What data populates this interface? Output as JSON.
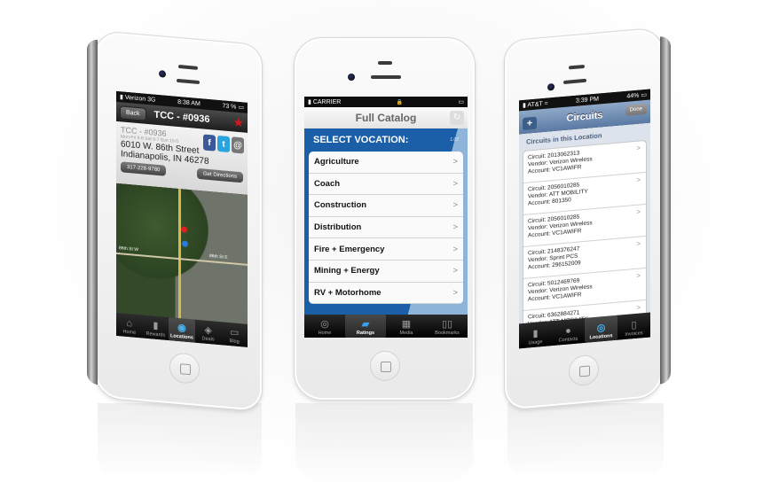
{
  "phones": {
    "left": {
      "status": {
        "carrier": "Verizon",
        "network": "3G",
        "time": "8:38 AM",
        "battery": "73 %"
      },
      "nav": {
        "back_label": "Back",
        "title": "TCC - #0936",
        "favorite_icon": "star-icon"
      },
      "location": {
        "name": "TCC - #0936",
        "hours": "Mon-Fri 9-8 Sat 9-7 Sun 10-5",
        "address_line1": "6010 W. 86th Street",
        "address_line2": "Indianapolis, IN 46278",
        "phone_button": "317-228-9780",
        "directions_button": "Get Directions",
        "social": [
          {
            "name": "facebook",
            "glyph": "f"
          },
          {
            "name": "twitter",
            "glyph": "t"
          },
          {
            "name": "email",
            "glyph": "@"
          }
        ]
      },
      "map": {
        "labels": [
          "86th St W",
          "86th St E"
        ]
      },
      "tabs": [
        {
          "label": "Home",
          "icon": "⌂",
          "active": false
        },
        {
          "label": "Rewards",
          "icon": "▮",
          "active": false
        },
        {
          "label": "Locations",
          "icon": "◉",
          "active": true
        },
        {
          "label": "Deals",
          "icon": "◈",
          "active": false
        },
        {
          "label": "Blog",
          "icon": "▭",
          "active": false
        }
      ]
    },
    "middle": {
      "status": {
        "carrier": "CARRIER",
        "lock_icon": "🔒"
      },
      "nav": {
        "title": "Full Catalog",
        "refresh_icon": "↻"
      },
      "header": {
        "title": "SELECT VOCATION:",
        "version": "1.02"
      },
      "vocations": [
        "Agriculture",
        "Coach",
        "Construction",
        "Distribution",
        "Fire + Emergency",
        "Mining + Energy",
        "RV + Motorhome"
      ],
      "chevron": ">",
      "tabs": [
        {
          "label": "Home",
          "icon": "◎",
          "active": false
        },
        {
          "label": "Ratings",
          "icon": "▰",
          "active": true
        },
        {
          "label": "Media",
          "icon": "▦",
          "active": false
        },
        {
          "label": "Bookmarks",
          "icon": "▯▯",
          "active": false
        }
      ]
    },
    "right": {
      "status": {
        "carrier": "AT&T",
        "time": "3:39 PM",
        "battery": "44%"
      },
      "nav": {
        "title": "Circuits",
        "add_label": "+",
        "done_label": "Done"
      },
      "section_title": "Circuits in this Location",
      "circuits": [
        {
          "circuit": "Circuit: 2013062313",
          "vendor": "Vendor: Verizon Wireless",
          "account": "Account: VC1AWIFR"
        },
        {
          "circuit": "Circuit: 2056010285",
          "vendor": "Vendor: ATT MOBILITY",
          "account": "Account: 801350"
        },
        {
          "circuit": "Circuit: 2056010285",
          "vendor": "Vendor: Verizon Wireless",
          "account": "Account: VC1AWIFR"
        },
        {
          "circuit": "Circuit: 2148376247",
          "vendor": "Vendor: Sprint PCS",
          "account": "Account: 296152009"
        },
        {
          "circuit": "Circuit: 5012469769",
          "vendor": "Vendor: Verizon Wireless",
          "account": "Account: VC1AWIFR"
        },
        {
          "circuit": "Circuit: 6362884271",
          "vendor": "Vendor: ATT MOBILITY",
          "account": ""
        }
      ],
      "chevron": ">",
      "tabs": [
        {
          "label": "Usage",
          "icon": "▮",
          "active": false
        },
        {
          "label": "Contacts",
          "icon": "●",
          "active": false
        },
        {
          "label": "Locations",
          "icon": "◎",
          "active": true
        },
        {
          "label": "Invoices",
          "icon": "▯",
          "active": false
        }
      ]
    }
  },
  "colors": {
    "vocation_blue": "#1b5fa8",
    "favorite_red": "#d21a1a",
    "facebook": "#3b5998",
    "twitter": "#2aa3df",
    "circuits_nav": "#5a7aa4"
  }
}
